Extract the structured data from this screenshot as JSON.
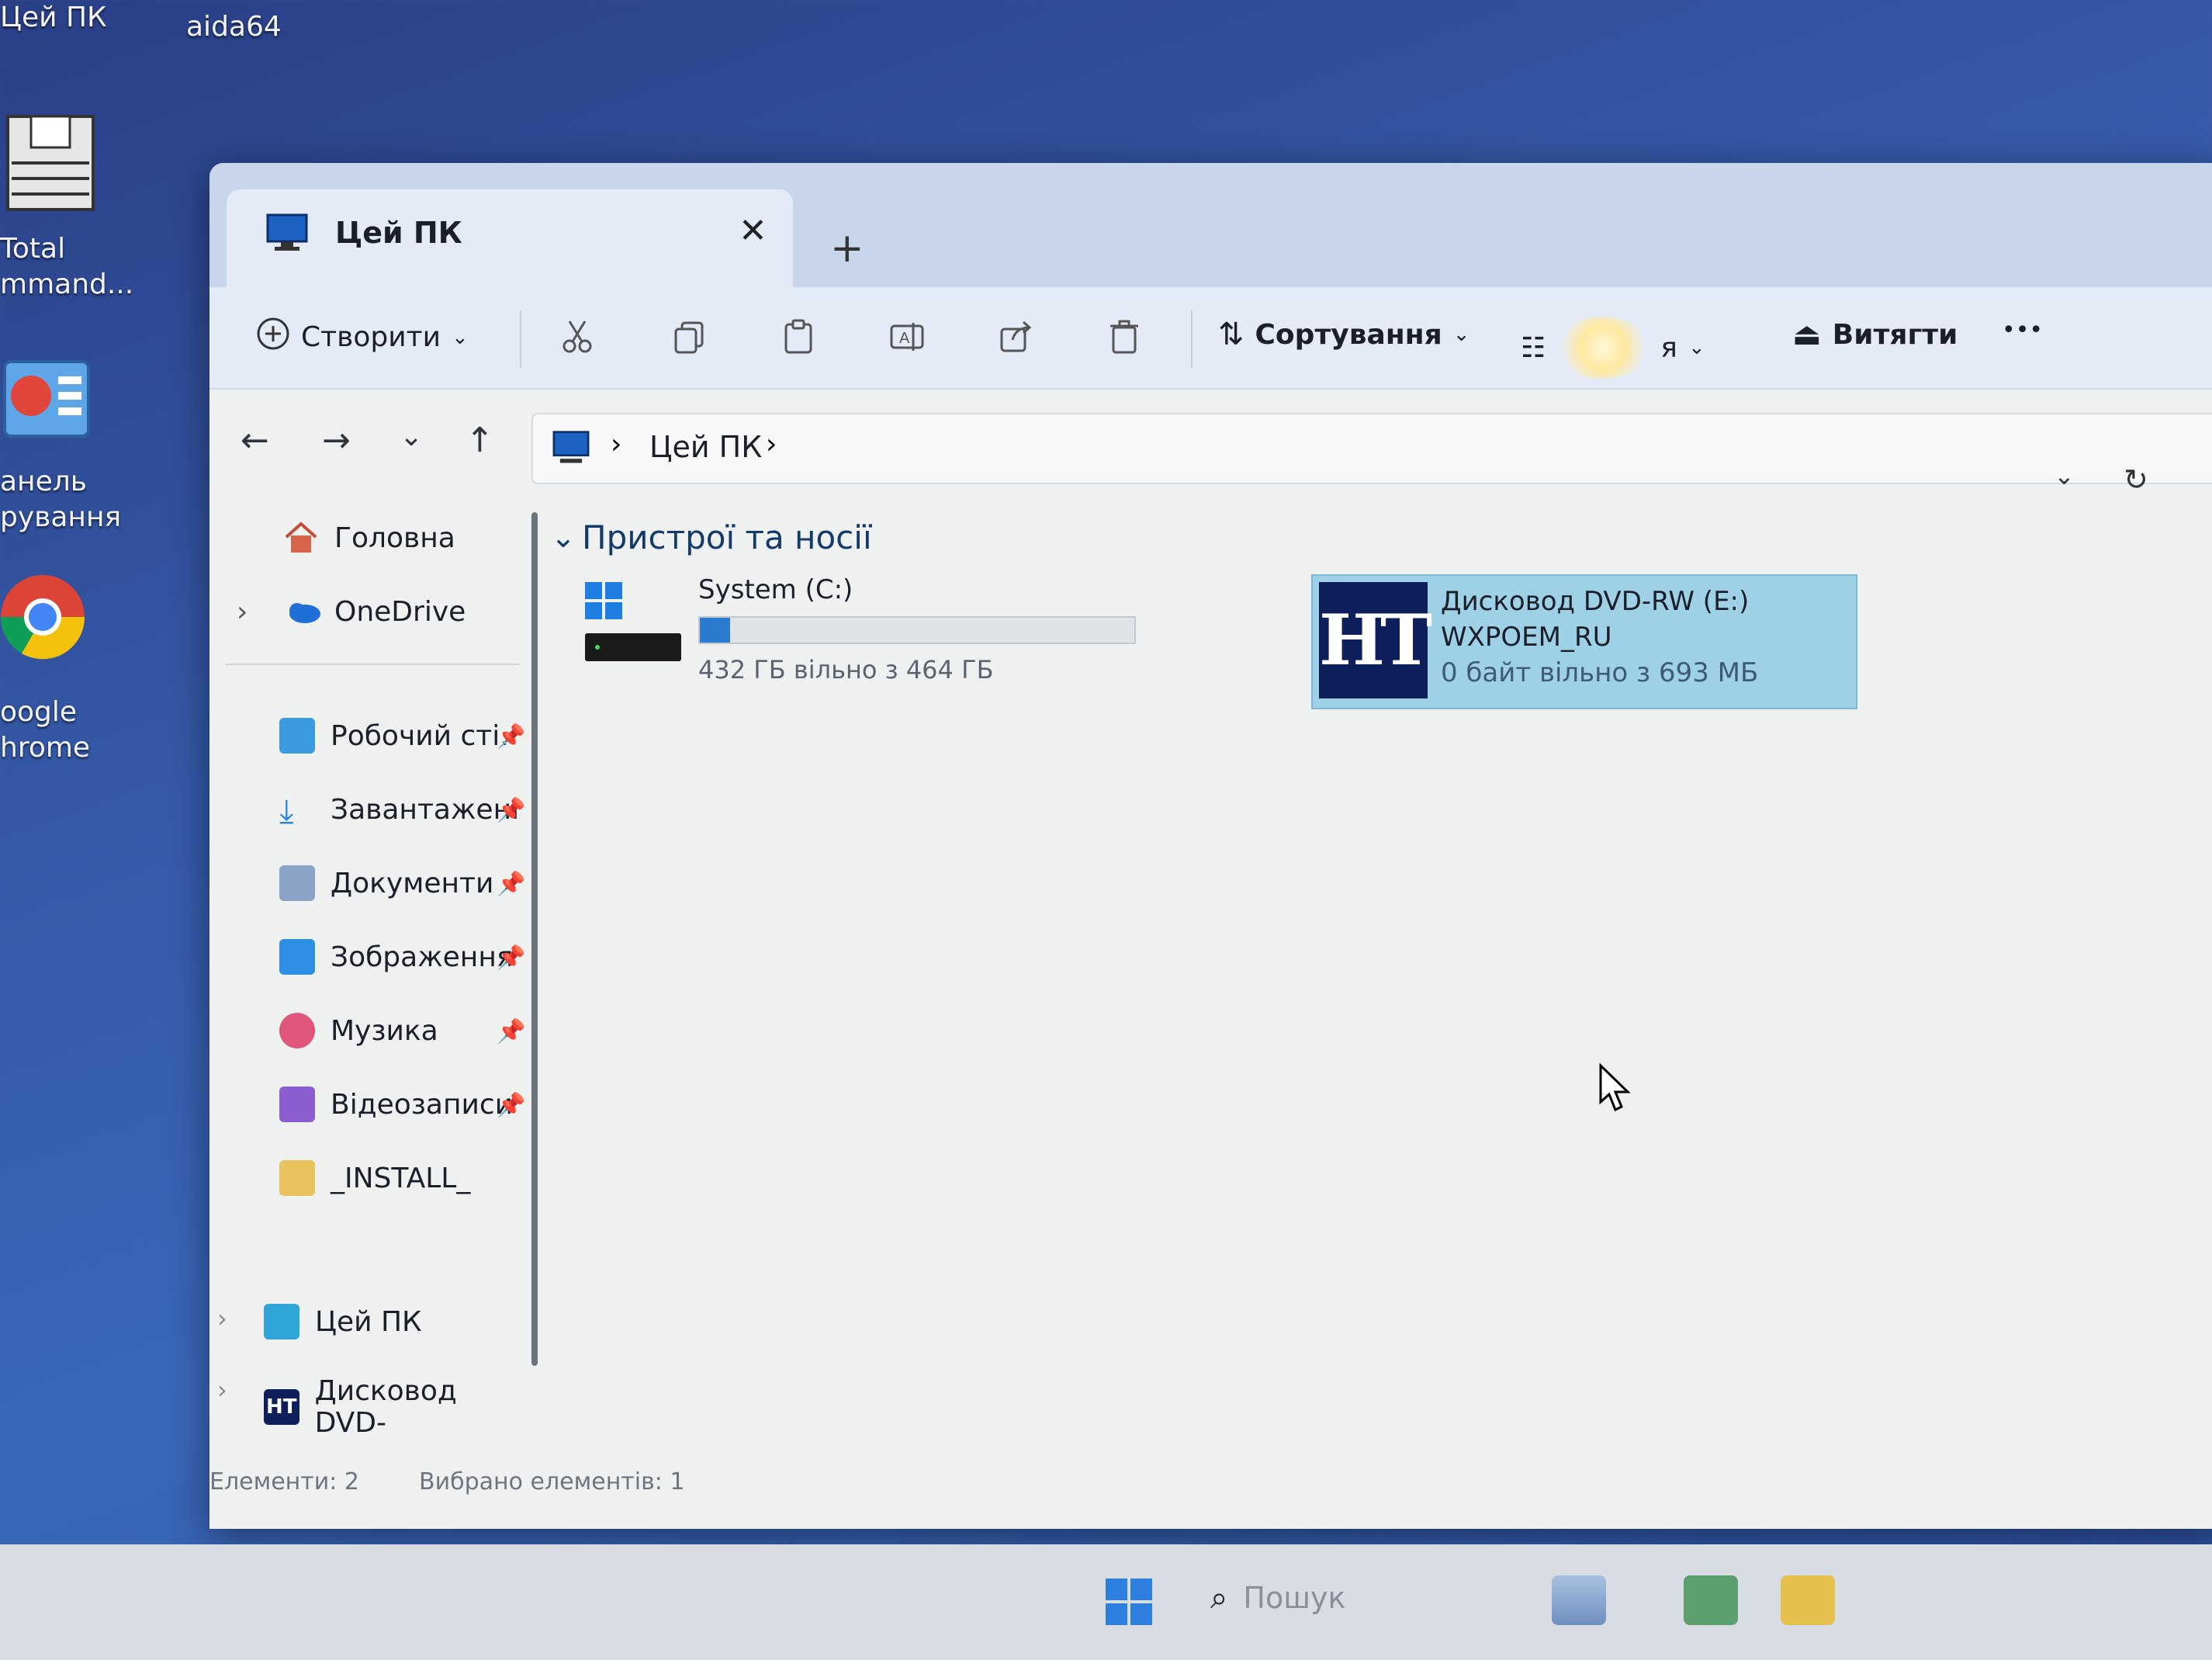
{
  "desktop": {
    "icons": [
      {
        "label": "Цей ПК"
      },
      {
        "label": "aida64"
      },
      {
        "label": "Total\nmmand..."
      },
      {
        "label": "анель\nрування"
      },
      {
        "label": "oogle\nhrome"
      }
    ]
  },
  "window": {
    "tab_title": "Цей ПК",
    "tab_close": "✕",
    "new_tab": "+",
    "toolbar": {
      "create_label": "Створити",
      "sort_label": "Сортування",
      "view_label": "я",
      "eject_label": "Витягти",
      "more_label": "•••"
    },
    "address": {
      "path": "Цей ПК"
    },
    "sidebar": {
      "home": "Головна",
      "onedrive": "OneDrive",
      "items": [
        {
          "label": "Робочий сті."
        },
        {
          "label": "Завантажені"
        },
        {
          "label": "Документи"
        },
        {
          "label": "Зображення"
        },
        {
          "label": "Музика"
        },
        {
          "label": "Відеозаписи"
        },
        {
          "label": "_INSTALL_"
        }
      ],
      "this_pc": "Цей ПК",
      "dvd": "Дисковод DVD-"
    },
    "content": {
      "group_title": "Пристрої та носії",
      "drives": [
        {
          "name": "System (C:)",
          "free_text": "432 ГБ вільно з 464 ГБ",
          "used_fraction": 0.07
        },
        {
          "name": "Дисковод DVD-RW (E:)",
          "label": "WXPOEM_RU",
          "free_text": "0 байт вільно з 693 МБ",
          "logo": "HT"
        }
      ]
    },
    "status": {
      "items": "Елементи: 2",
      "selected": "Вибрано елементів: 1"
    }
  },
  "taskbar": {
    "search_placeholder": "Пошук"
  },
  "colors": {
    "accent": "#2b7bd1",
    "selection": "#9ed0e6",
    "desktop": "#355aa8"
  }
}
